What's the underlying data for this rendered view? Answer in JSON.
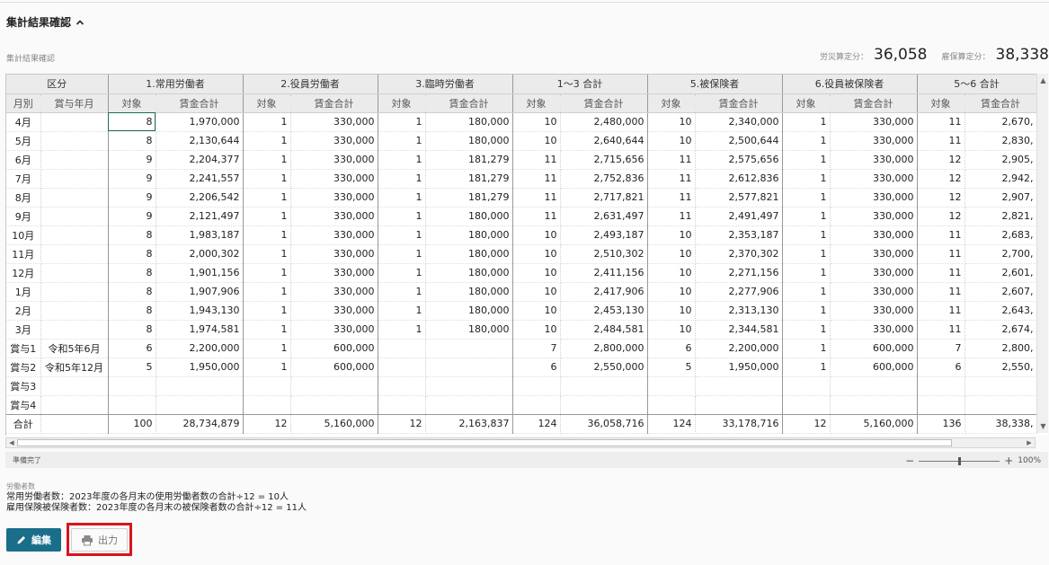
{
  "section": {
    "title": "集計結果確認"
  },
  "sub_label": "集計結果確認",
  "summary": {
    "rosai_label": "労災算定分：",
    "rosai_value": "36,058",
    "koyo_label": "雇保算定分：",
    "koyo_value": "38,338"
  },
  "grid": {
    "group_headers": [
      "区分",
      "1.常用労働者",
      "2.役員労働者",
      "3.臨時労働者",
      "1～3 合計",
      "5.被保険者",
      "6.役員被保険者",
      "5～6 合計"
    ],
    "sub_headers": [
      "月別",
      "賞与年月",
      "対象",
      "賃金合計",
      "対象",
      "賃金合計",
      "対象",
      "賃金合計",
      "対象",
      "賃金合計",
      "対象",
      "賃金合計",
      "対象",
      "賃金合計",
      "対象",
      "賃金合計"
    ],
    "rows": [
      [
        "4月",
        "",
        "8",
        "1,970,000",
        "1",
        "330,000",
        "1",
        "180,000",
        "10",
        "2,480,000",
        "10",
        "2,340,000",
        "1",
        "330,000",
        "11",
        "2,670,"
      ],
      [
        "5月",
        "",
        "8",
        "2,130,644",
        "1",
        "330,000",
        "1",
        "180,000",
        "10",
        "2,640,644",
        "10",
        "2,500,644",
        "1",
        "330,000",
        "11",
        "2,830,"
      ],
      [
        "6月",
        "",
        "9",
        "2,204,377",
        "1",
        "330,000",
        "1",
        "181,279",
        "11",
        "2,715,656",
        "11",
        "2,575,656",
        "1",
        "330,000",
        "12",
        "2,905,"
      ],
      [
        "7月",
        "",
        "9",
        "2,241,557",
        "1",
        "330,000",
        "1",
        "181,279",
        "11",
        "2,752,836",
        "11",
        "2,612,836",
        "1",
        "330,000",
        "12",
        "2,942,"
      ],
      [
        "8月",
        "",
        "9",
        "2,206,542",
        "1",
        "330,000",
        "1",
        "181,279",
        "11",
        "2,717,821",
        "11",
        "2,577,821",
        "1",
        "330,000",
        "12",
        "2,907,"
      ],
      [
        "9月",
        "",
        "9",
        "2,121,497",
        "1",
        "330,000",
        "1",
        "180,000",
        "11",
        "2,631,497",
        "11",
        "2,491,497",
        "1",
        "330,000",
        "12",
        "2,821,"
      ],
      [
        "10月",
        "",
        "8",
        "1,983,187",
        "1",
        "330,000",
        "1",
        "180,000",
        "10",
        "2,493,187",
        "10",
        "2,353,187",
        "1",
        "330,000",
        "11",
        "2,683,"
      ],
      [
        "11月",
        "",
        "8",
        "2,000,302",
        "1",
        "330,000",
        "1",
        "180,000",
        "10",
        "2,510,302",
        "10",
        "2,370,302",
        "1",
        "330,000",
        "11",
        "2,700,"
      ],
      [
        "12月",
        "",
        "8",
        "1,901,156",
        "1",
        "330,000",
        "1",
        "180,000",
        "10",
        "2,411,156",
        "10",
        "2,271,156",
        "1",
        "330,000",
        "11",
        "2,601,"
      ],
      [
        "1月",
        "",
        "8",
        "1,907,906",
        "1",
        "330,000",
        "1",
        "180,000",
        "10",
        "2,417,906",
        "10",
        "2,277,906",
        "1",
        "330,000",
        "11",
        "2,607,"
      ],
      [
        "2月",
        "",
        "8",
        "1,943,130",
        "1",
        "330,000",
        "1",
        "180,000",
        "10",
        "2,453,130",
        "10",
        "2,313,130",
        "1",
        "330,000",
        "11",
        "2,643,"
      ],
      [
        "3月",
        "",
        "8",
        "1,974,581",
        "1",
        "330,000",
        "1",
        "180,000",
        "10",
        "2,484,581",
        "10",
        "2,344,581",
        "1",
        "330,000",
        "11",
        "2,674,"
      ],
      [
        "賞与1",
        "令和5年6月",
        "6",
        "2,200,000",
        "1",
        "600,000",
        "",
        "",
        "7",
        "2,800,000",
        "6",
        "2,200,000",
        "1",
        "600,000",
        "7",
        "2,800,"
      ],
      [
        "賞与2",
        "令和5年12月",
        "5",
        "1,950,000",
        "1",
        "600,000",
        "",
        "",
        "6",
        "2,550,000",
        "5",
        "1,950,000",
        "1",
        "600,000",
        "6",
        "2,550,"
      ],
      [
        "賞与3",
        "",
        "",
        "",
        "",
        "",
        "",
        "",
        "",
        "",
        "",
        "",
        "",
        "",
        "",
        ""
      ],
      [
        "賞与4",
        "",
        "",
        "",
        "",
        "",
        "",
        "",
        "",
        "",
        "",
        "",
        "",
        "",
        "",
        ""
      ],
      [
        "合計",
        "",
        "100",
        "28,734,879",
        "12",
        "5,160,000",
        "12",
        "2,163,837",
        "124",
        "36,058,716",
        "124",
        "33,178,716",
        "12",
        "5,160,000",
        "136",
        "38,338,"
      ]
    ]
  },
  "status": {
    "text": "準備完了",
    "zoom": "100%",
    "zoom_minus": "−",
    "zoom_plus": "+"
  },
  "workers": {
    "caption": "労働者数",
    "line1": "常用労働者数：2023年度の各月末の使用労働者数の合計÷12 = 10人",
    "line2": "雇用保険被保険者数：2023年度の各月末の被保険者数の合計÷12 = 11人"
  },
  "buttons": {
    "edit": "編集",
    "output": "出力"
  },
  "colors": {
    "edit_button": "#1a6e8a",
    "highlight_box": "#d8141e"
  }
}
